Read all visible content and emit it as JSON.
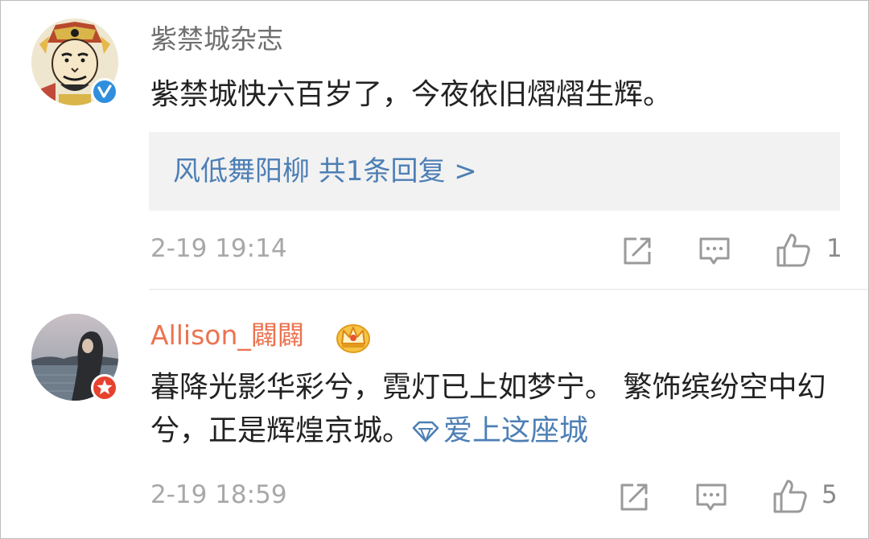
{
  "comments": [
    {
      "username": "紫禁城杂志",
      "badge_icon": "verified-v-icon",
      "badge_color": "#2f8fdd",
      "text": "紫禁城快六百岁了，今夜依旧熠熠生辉。",
      "reply_summary": "风低舞阳柳  共1条回复 >",
      "time": "2-19 19:14",
      "like_count": "1"
    },
    {
      "username": "Allison_闢闢",
      "user_color": "#eb7350",
      "badge_icon": "weibo-star-icon",
      "badge_color": "#e6422f",
      "member_icon": "crown-icon",
      "text": "暮降光影华彩兮，霓灯已上如梦宁。 繁饰缤纷空中幻兮，正是辉煌京城。",
      "link_text": "爱上这座城",
      "time": "2-19 18:59",
      "like_count": "5"
    }
  ],
  "colors": {
    "link": "#4d7fb5",
    "text": "#222222",
    "meta": "#a8a8a8",
    "reply_bg": "#f2f2f2"
  }
}
